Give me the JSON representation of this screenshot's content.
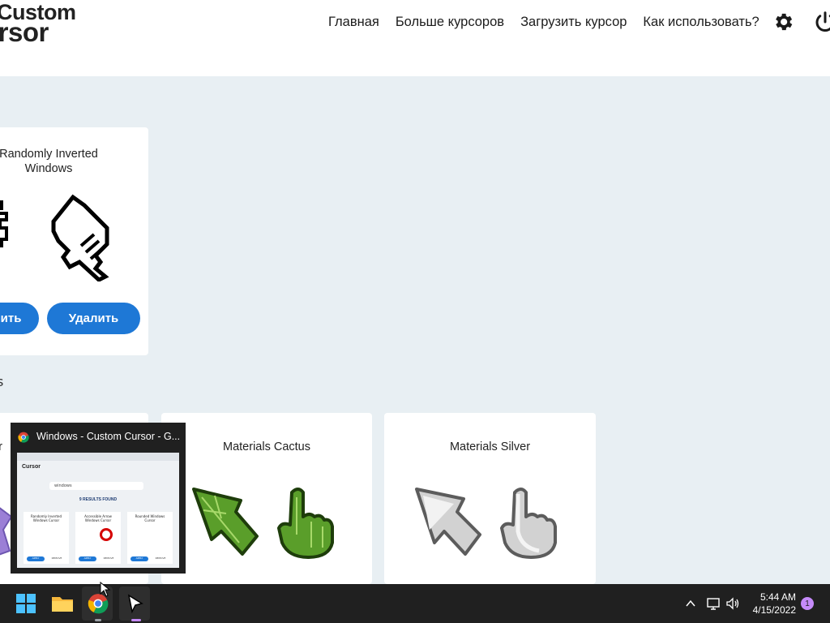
{
  "header": {
    "logo_line1": "Custom",
    "logo_line2": "ursor",
    "nav": [
      "Главная",
      "Больше курсоров",
      "Загрузить курсор",
      "Как использовать?"
    ]
  },
  "cards": [
    {
      "title": "Randomly Inverted Windows",
      "apply_label": "нить",
      "delete_label": "Удалить"
    },
    {
      "title": "Materials Cactus"
    },
    {
      "title": "Materials Silver"
    }
  ],
  "section_fragment": "s",
  "card_left_fragment": "er",
  "preview": {
    "title": "Windows - Custom Cursor - G...",
    "thumb_logo": "Cursor",
    "thumb_results": "9 RESULTS FOUND",
    "thumb_search": "windows",
    "thumb_cards": [
      "Randomly Inverted Windows Cursor",
      "Accessible Arrow Windows Cursor",
      "Rounded Windows Cursor"
    ],
    "thumb_btn_apply": "APPLY",
    "thumb_btn_remove": "REMOVE"
  },
  "taskbar": {
    "time": "5:44 AM",
    "date": "4/15/2022",
    "notifications": "1"
  },
  "colors": {
    "accent": "#1e78d6",
    "page_bg": "#e8eff3",
    "taskbar": "#202020",
    "cactus": "#5a9e2a",
    "silver": "#cfcfcf"
  }
}
